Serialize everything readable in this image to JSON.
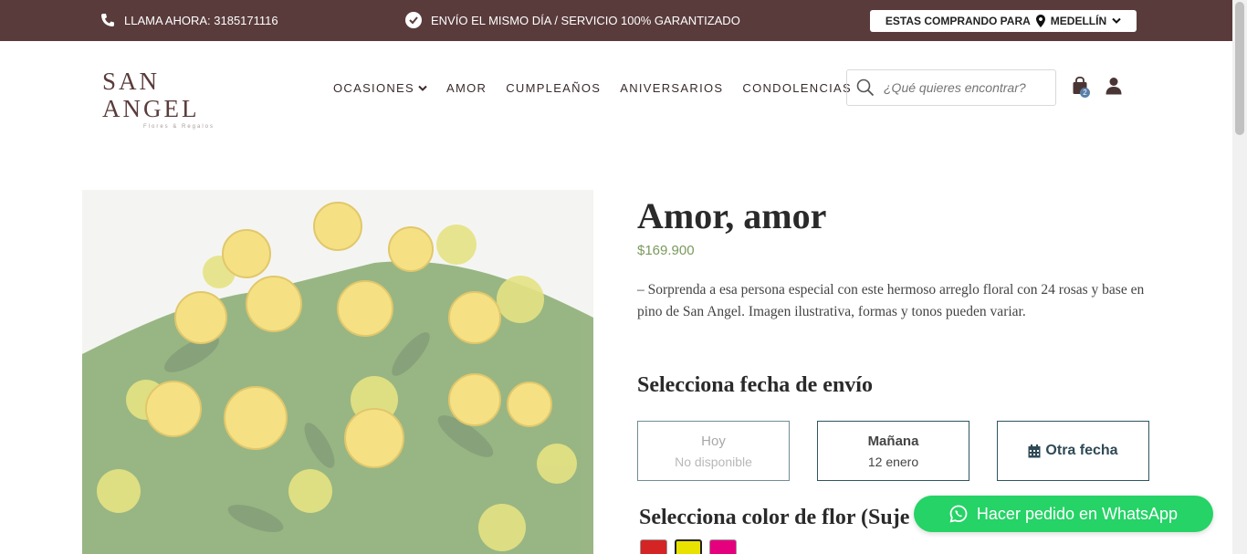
{
  "topbar": {
    "call_text": "LLAMA AHORA: 3185171116",
    "shipping_text": "ENVÍO EL MISMO DÍA / SERVICIO 100% GARANTIZADO",
    "buying_for_label": "ESTAS COMPRANDO PARA",
    "city": "MEDELLÍN"
  },
  "header": {
    "logo_name": "SAN ANGEL",
    "logo_tagline": "Flores & Regalos",
    "nav": [
      {
        "label": "OCASIONES"
      },
      {
        "label": "AMOR"
      },
      {
        "label": "CUMPLEAÑOS"
      },
      {
        "label": "ANIVERSARIOS"
      },
      {
        "label": "CONDOLENCIAS"
      }
    ],
    "search_placeholder": "¿Qué quieres encontrar?",
    "cart_count": "2"
  },
  "product": {
    "title": "Amor, amor",
    "price": "$169.900",
    "description": "– Sorprenda a esa persona especial con este hermoso arreglo floral con 24 rosas y base en pino de San Angel. Imagen ilustrativa, formas y tonos pueden variar."
  },
  "delivery": {
    "heading": "Selecciona fecha de envío",
    "today_label": "Hoy",
    "today_status": "No disponible",
    "tomorrow_label": "Mañana",
    "tomorrow_date": "12 enero",
    "other_label": "Otra fecha"
  },
  "color": {
    "heading": "Selecciona color de flor (Suje",
    "swatches": [
      "#d42424",
      "#e9e200",
      "#e5007e"
    ]
  },
  "whatsapp": {
    "label": "Hacer pedido en WhatsApp"
  },
  "colors": {
    "topbar_bg": "#5a3b3b",
    "price": "#7a9a5e",
    "whatsapp": "#25d366",
    "box_border": "#2f5560"
  }
}
